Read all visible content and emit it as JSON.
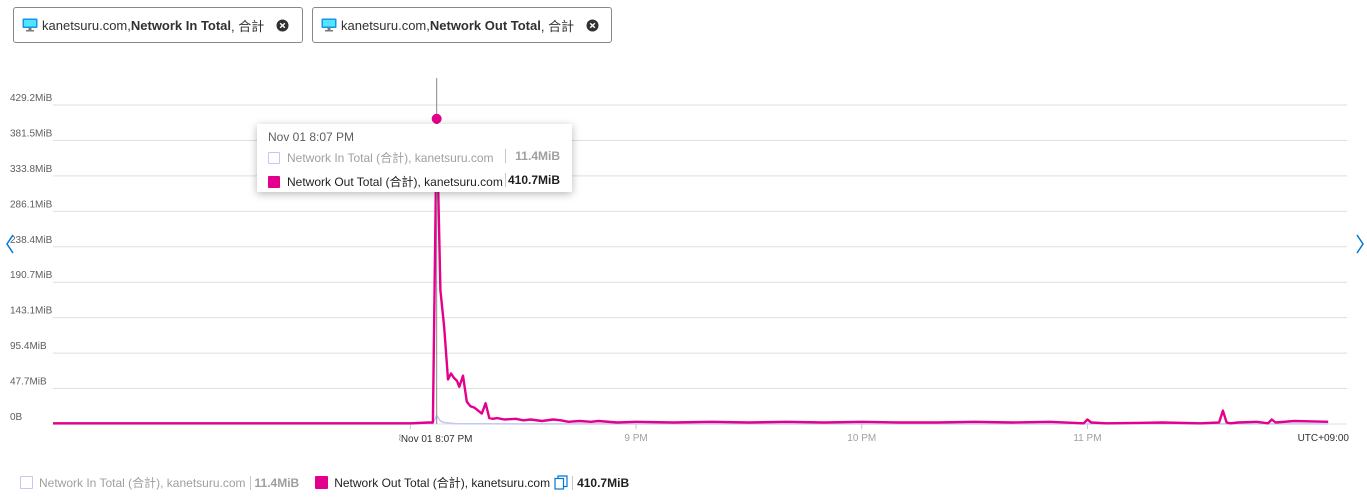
{
  "pills": [
    {
      "resource": "kanetsuru.com, ",
      "metric": "Network In Total",
      "agg": ", 合計"
    },
    {
      "resource": "kanetsuru.com, ",
      "metric": "Network Out Total",
      "agg": ", 合計"
    }
  ],
  "tooltip": {
    "title": "Nov 01 8:07 PM",
    "rows": [
      {
        "label": "Network In Total (合計), kanetsuru.com",
        "value": "11.4MiB"
      },
      {
        "label": "Network Out Total (合計), kanetsuru.com",
        "value": "410.7MiB"
      }
    ]
  },
  "legend": [
    {
      "label": "Network In Total (合計), kanetsuru.com",
      "value": "11.4MiB"
    },
    {
      "label": "Network Out Total (合計), kanetsuru.com",
      "value": "410.7MiB"
    }
  ],
  "colors": {
    "in": "#c3c8ee",
    "out": "#e3008c"
  },
  "icons": [
    "vm-icon",
    "close-icon",
    "chevron-left-icon",
    "chevron-right-icon",
    "copy-icon"
  ],
  "chart_data": {
    "type": "line",
    "title": "",
    "xlabel": "",
    "ylabel": "",
    "ylim": [
      0,
      429.2
    ],
    "y_ticks": [
      "0B",
      "47.7MiB",
      "95.4MiB",
      "143.1MiB",
      "190.7MiB",
      "238.4MiB",
      "286.1MiB",
      "333.8MiB",
      "381.5MiB",
      "429.2MiB"
    ],
    "x_range_minutes": [
      -95,
      249
    ],
    "x_ticks": [
      {
        "min": 0,
        "label": "8 PM"
      },
      {
        "min": 60,
        "label": "9 PM"
      },
      {
        "min": 120,
        "label": "10 PM"
      },
      {
        "min": 180,
        "label": "11 PM"
      }
    ],
    "crosshair": {
      "min": 7,
      "label": "Nov 01 8:07 PM"
    },
    "timezone_label": "UTC+09:00",
    "grid": true,
    "legend_position": "bottom-left",
    "series": [
      {
        "name": "Network In Total (合計), kanetsuru.com",
        "x": [
          -95,
          -60,
          -30,
          0,
          5,
          6,
          7,
          8,
          9,
          10,
          11,
          12,
          15,
          20,
          60,
          120,
          180,
          220,
          244
        ],
        "y": [
          0,
          0,
          0,
          0,
          0.5,
          1,
          11.4,
          4,
          2,
          1.5,
          1,
          0.6,
          0.4,
          0.3,
          0.2,
          0.2,
          0.2,
          0.2,
          0.2
        ]
      },
      {
        "name": "Network Out Total (合計), kanetsuru.com",
        "x": [
          -95,
          -80,
          -60,
          -40,
          -20,
          -5,
          0,
          5,
          6,
          7,
          8,
          9,
          10,
          10.8,
          11.6,
          12.4,
          13,
          14,
          15,
          16,
          17,
          18,
          19,
          20,
          21,
          22,
          23,
          25,
          28,
          30,
          32,
          35,
          38,
          40,
          42,
          45,
          48,
          50,
          55,
          60,
          70,
          80,
          90,
          100,
          110,
          120,
          130,
          140,
          150,
          160,
          170,
          179,
          180,
          181,
          185,
          200,
          210,
          215,
          216,
          217,
          218,
          220,
          225,
          228,
          229,
          230,
          235,
          244
        ],
        "y": [
          1,
          1,
          1,
          1,
          1,
          1,
          1,
          2,
          2,
          410.7,
          180,
          130,
          60,
          68,
          62,
          58,
          50,
          65,
          30,
          24,
          22,
          18,
          14,
          28,
          8,
          7,
          8,
          6,
          7,
          5,
          6,
          4,
          6,
          5,
          3,
          4,
          3,
          4,
          2,
          3,
          2,
          3,
          2,
          3,
          2,
          3,
          2,
          2,
          3,
          2,
          3,
          1,
          6,
          2,
          1,
          2,
          1,
          2,
          18,
          2,
          1,
          2,
          3,
          1,
          6,
          2,
          4,
          3
        ]
      }
    ]
  }
}
